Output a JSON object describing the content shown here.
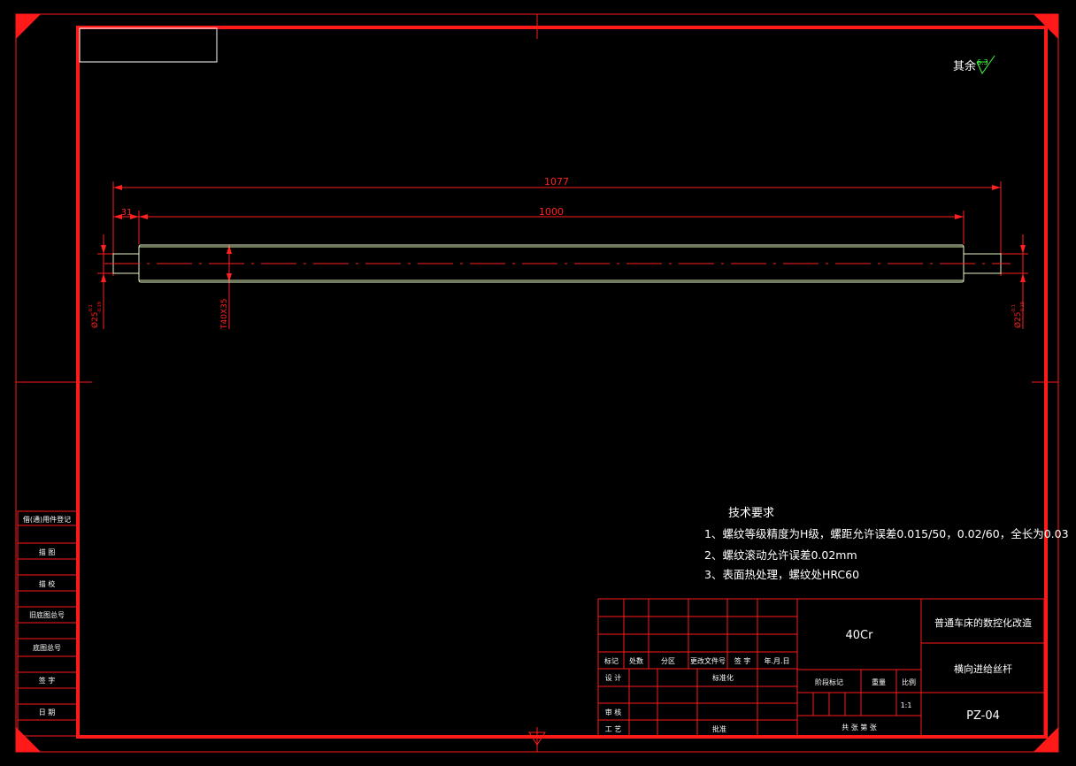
{
  "roughness": {
    "label": "其余",
    "value": "6.3"
  },
  "dimensions": {
    "overall_length": "1077",
    "thread_length": "1000",
    "end_length": "31",
    "left_diameter": "Ø25",
    "left_tol_upper": "-0.1",
    "left_tol_lower": "-0.19",
    "right_diameter": "Ø25",
    "right_tol_upper": "-0.1",
    "right_tol_lower": "-0.19",
    "thread_spec": "T40X35"
  },
  "tech_requirements": {
    "title": "技术要求",
    "lines": [
      "1、螺纹等级精度为H级，螺距允许误差0.015/50，0.02/60，全长为0.03",
      "2、螺纹滚动允许误差0.02mm",
      "3、表面热处理，螺纹处HRC60"
    ]
  },
  "side_panel": [
    "借(通)用件登记",
    "描 图",
    "描 校",
    "旧底图总号",
    "底图总号",
    "签 字",
    "日 期"
  ],
  "title_block": {
    "material": "40Cr",
    "project": "普通车床的数控化改造",
    "part_name": "横向进给丝杆",
    "drawing_no": "PZ-04",
    "headers": [
      "标记",
      "处数",
      "分区",
      "更改文件号",
      "签 字",
      "年.月.日"
    ],
    "design": "设 计",
    "standardize": "标准化",
    "review": "审 核",
    "process": "工 艺",
    "approve": "批准",
    "stage_mark": "阶段标记",
    "weight": "重量",
    "scale_label": "比例",
    "scale": "1:1",
    "sheets": "共    张    第    张"
  },
  "colors": {
    "frame": "#ff1a1a",
    "part": "#e8f5c8",
    "text": "#ffffff",
    "dim": "#ff2020"
  }
}
